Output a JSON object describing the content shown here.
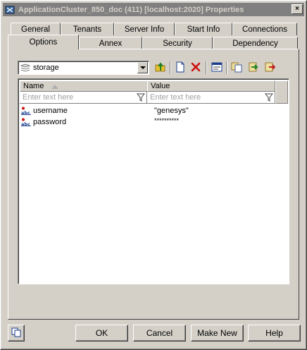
{
  "window": {
    "title": "ApplicationCluster_850_doc (411) [localhost:2020] Properties",
    "close_symbol": "×"
  },
  "tabs": {
    "row1": [
      "General",
      "Tenants",
      "Server Info",
      "Start Info",
      "Connections"
    ],
    "row2": [
      "Options",
      "Annex",
      "Security",
      "Dependency"
    ],
    "active": "Options"
  },
  "toolbar": {
    "section_select": "storage",
    "icons": [
      "up-folder-icon",
      "new-item-icon",
      "delete-icon",
      "properties-icon",
      "copy-icon",
      "import-icon",
      "export-icon"
    ]
  },
  "grid": {
    "columns": {
      "name": "Name",
      "value": "Value"
    },
    "filter_placeholder": "Enter text here",
    "rows": [
      {
        "name": "username",
        "value": "\"genesys\""
      },
      {
        "name": "password",
        "value": "**********"
      }
    ]
  },
  "buttons": {
    "ok": "OK",
    "cancel": "Cancel",
    "make_new": "Make New",
    "help": "Help"
  },
  "colors": {
    "face": "#d4d0c8",
    "title_inactive": "#808080",
    "title_text": "#d4d0c8",
    "delete_red": "#d01010",
    "icon_blue": "#1a3c8c"
  }
}
